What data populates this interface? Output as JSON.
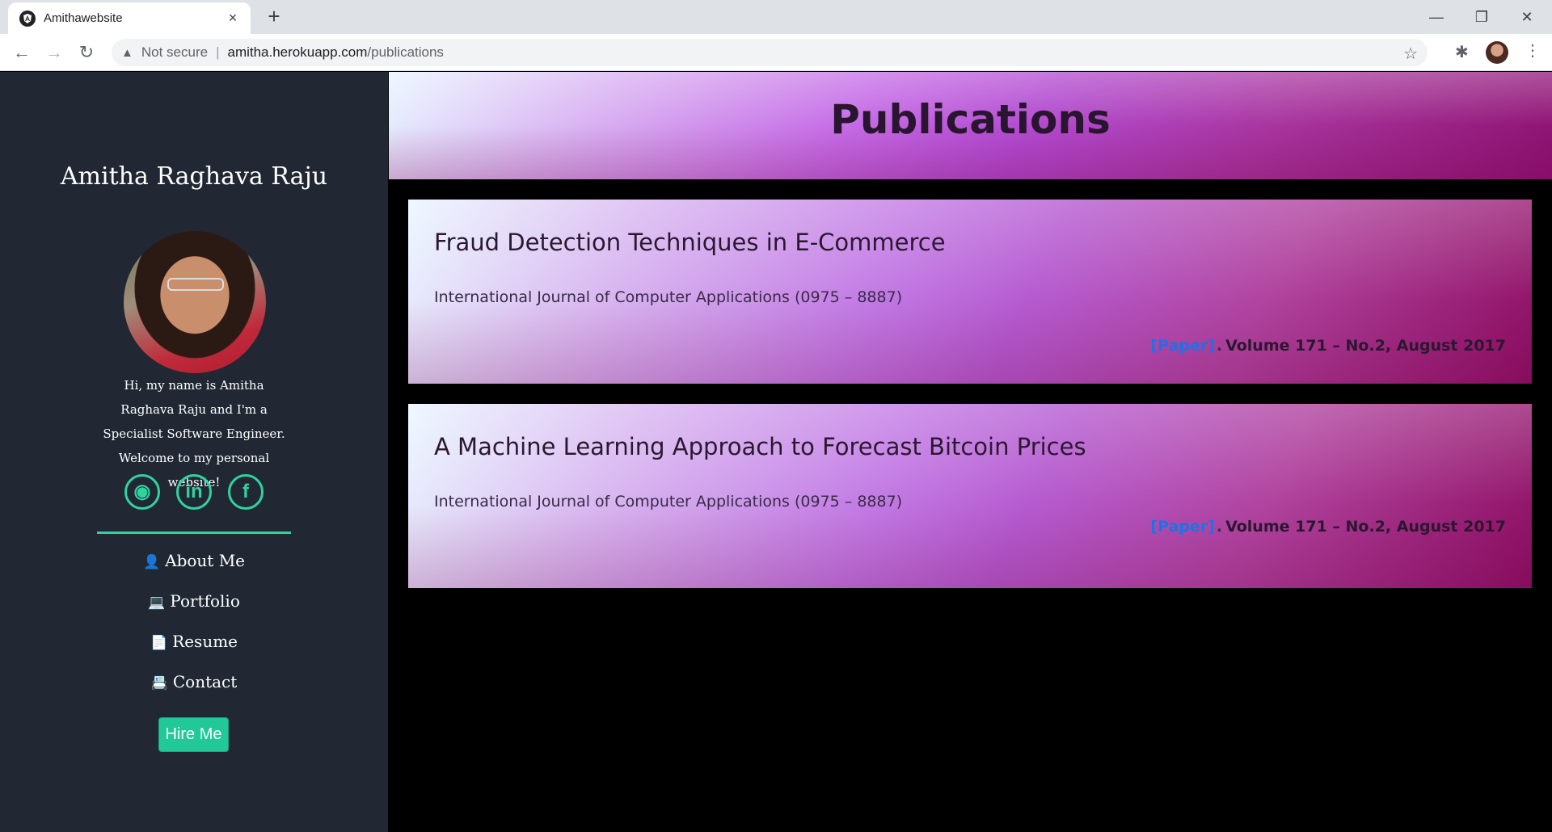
{
  "browser": {
    "tab_title": "Amithawebsite",
    "tab_close": "×",
    "new_tab": "+",
    "not_secure": "Not secure",
    "separator": "|",
    "url_host": "amitha.herokuapp.com",
    "url_path": "/publications",
    "minimize": "—",
    "restore": "❐",
    "close": "✕",
    "back": "←",
    "forward": "→",
    "reload": "↻",
    "warning": "▲",
    "star": "☆",
    "extensions": "✱",
    "menu": "⋮"
  },
  "sidebar": {
    "name": "Amitha Raghava Raju",
    "bio": "Hi, my name is Amitha Raghava Raju and I'm a Specialist Software Engineer. Welcome to my personal website!",
    "socials": [
      {
        "icon": "github-icon",
        "glyph": "◉"
      },
      {
        "icon": "linkedin-icon",
        "glyph": "in"
      },
      {
        "icon": "facebook-icon",
        "glyph": "f"
      }
    ],
    "nav": [
      {
        "label": "About Me",
        "icon": "user-icon",
        "glyph": "👤"
      },
      {
        "label": "Portfolio",
        "icon": "laptop-icon",
        "glyph": "💻"
      },
      {
        "label": "Resume",
        "icon": "file-icon",
        "glyph": "📄"
      },
      {
        "label": "Contact",
        "icon": "contact-card-icon",
        "glyph": "📇"
      }
    ],
    "hire_button": "Hire Me",
    "accent_color": "#20c997"
  },
  "main": {
    "title": "Publications",
    "publications": [
      {
        "title": "Fraud Detection Techniques in E-Commerce",
        "journal": "International Journal of Computer Applications (0975 – 8887)",
        "paper_link": "[Paper]",
        "dot": ".",
        "volume": "Volume 171 – No.2, August 2017"
      },
      {
        "title": "A Machine Learning Approach to Forecast Bitcoin Prices",
        "journal": "International Journal of Computer Applications (0975 – 8887)",
        "paper_link": "[Paper]",
        "dot": ".",
        "volume": "Volume 171 – No.2, August 2017"
      }
    ]
  }
}
